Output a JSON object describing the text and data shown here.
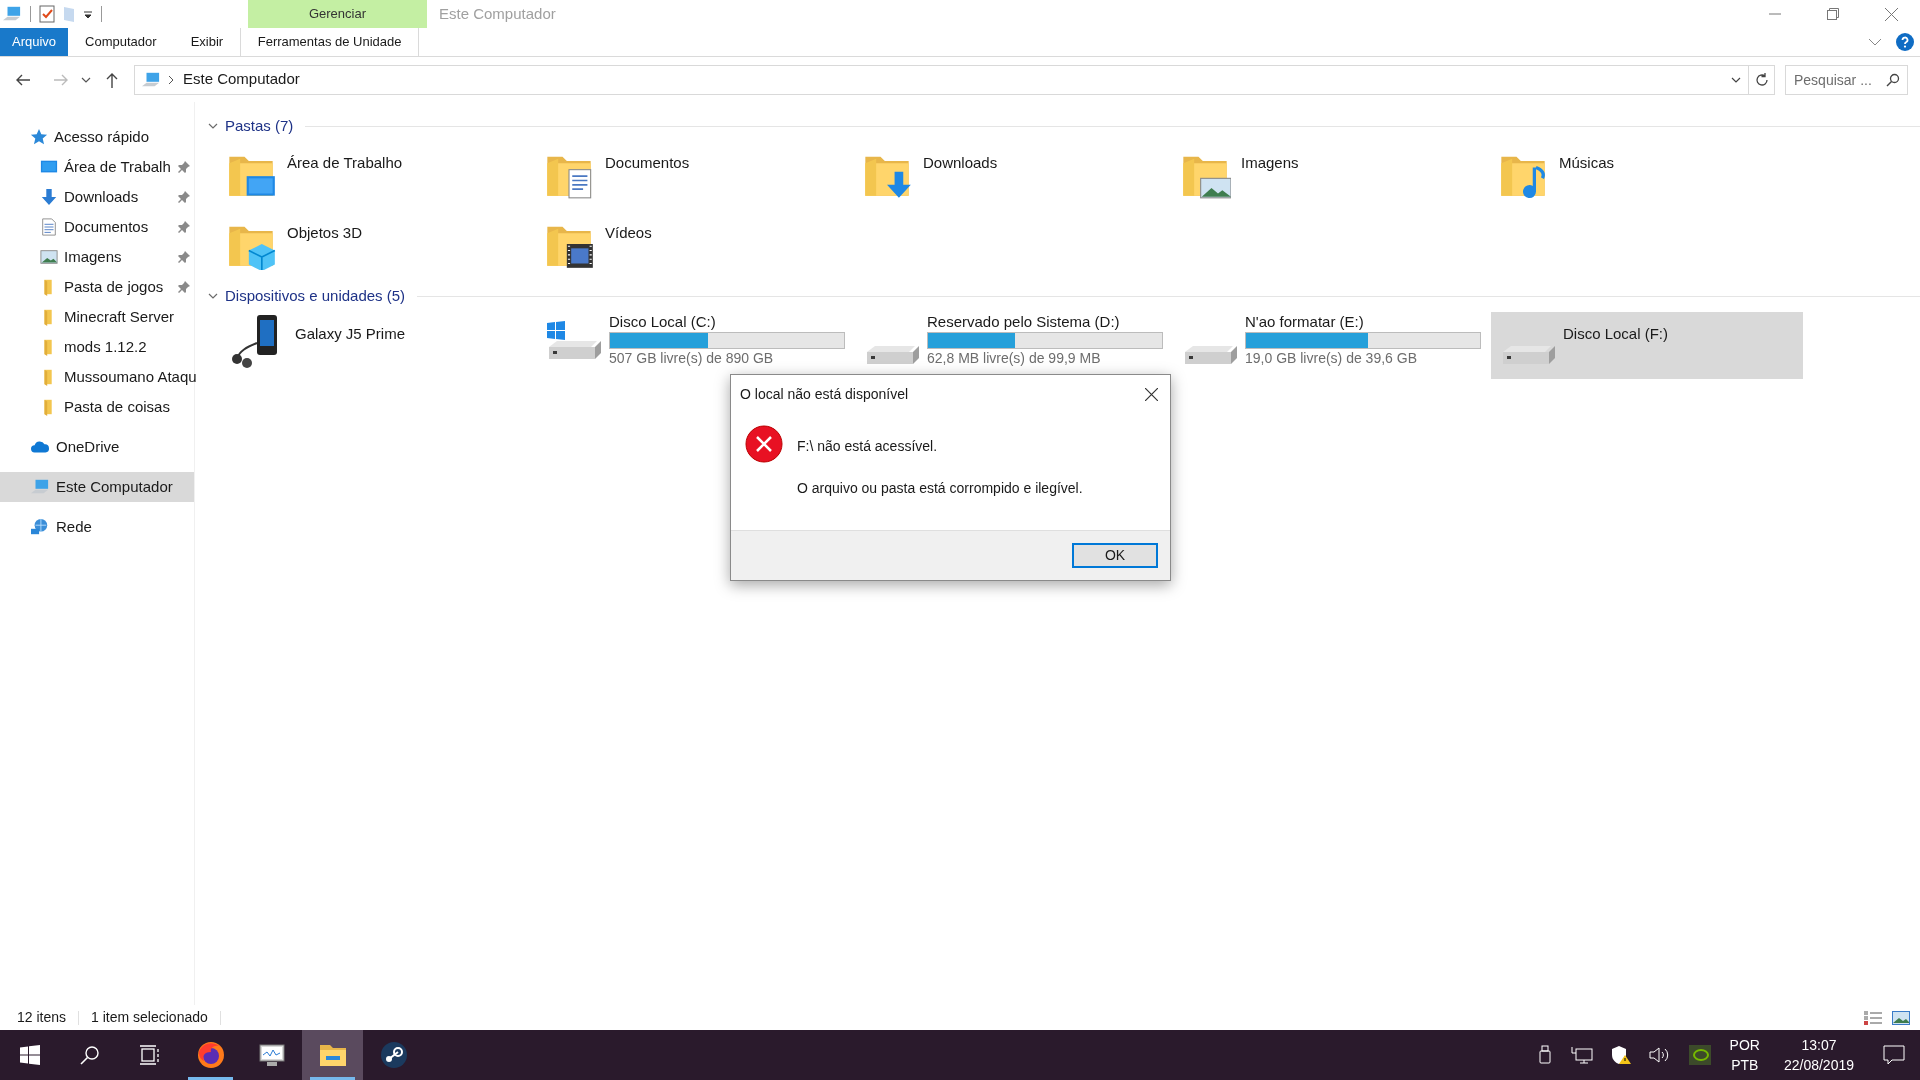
{
  "window": {
    "title": "Este Computador"
  },
  "ribbon": {
    "context_group": "Gerenciar",
    "tabs": [
      {
        "label": "Arquivo",
        "kind": "file",
        "selected": false
      },
      {
        "label": "Computador",
        "kind": "tab",
        "selected": false
      },
      {
        "label": "Exibir",
        "kind": "tab",
        "selected": false
      },
      {
        "label": "Ferramentas de Unidade",
        "kind": "context",
        "selected": false
      }
    ]
  },
  "address_bar": {
    "path": "Este Computador"
  },
  "search": {
    "placeholder": "Pesquisar ..."
  },
  "sidebar": {
    "items": [
      {
        "label": "Acesso rápido",
        "kind": "star",
        "selected": false,
        "children": [
          {
            "label": "Área de Trabalh",
            "kind": "desktop",
            "pinned": true
          },
          {
            "label": "Downloads",
            "kind": "downloads",
            "pinned": true
          },
          {
            "label": "Documentos",
            "kind": "documents",
            "pinned": true
          },
          {
            "label": "Imagens",
            "kind": "pictures",
            "pinned": true
          },
          {
            "label": "Pasta de jogos",
            "kind": "folder",
            "pinned": true
          },
          {
            "label": "Minecraft Server",
            "kind": "folder",
            "pinned": false
          },
          {
            "label": "mods 1.12.2",
            "kind": "folder",
            "pinned": false
          },
          {
            "label": "Mussoumano Ataqu",
            "kind": "folder",
            "pinned": false
          },
          {
            "label": "Pasta de coisas",
            "kind": "folder",
            "pinned": false
          }
        ]
      },
      {
        "label": "OneDrive",
        "kind": "cloud",
        "selected": false
      },
      {
        "label": "Este Computador",
        "kind": "computer",
        "selected": true
      },
      {
        "label": "Rede",
        "kind": "network",
        "selected": false
      }
    ]
  },
  "folders": {
    "heading": "Pastas (7)",
    "expanded": true,
    "items": [
      {
        "label": "Área de Trabalho",
        "kind": "desktop"
      },
      {
        "label": "Documentos",
        "kind": "documents"
      },
      {
        "label": "Downloads",
        "kind": "downloads"
      },
      {
        "label": "Imagens",
        "kind": "pictures"
      },
      {
        "label": "Músicas",
        "kind": "music"
      },
      {
        "label": "Objetos 3D",
        "kind": "objects"
      },
      {
        "label": "Vídeos",
        "kind": "videos"
      }
    ]
  },
  "devices": {
    "heading": "Dispositivos e unidades (5)",
    "expanded": true,
    "items": [
      {
        "label": "Galaxy J5 Prime",
        "kind": "phone",
        "selected": false
      },
      {
        "label": "Disco Local (C:)",
        "kind": "system-drive",
        "level": 0.42,
        "free": "507 GB livre(s) de 890 GB",
        "selected": false
      },
      {
        "label": "Reservado pelo Sistema (D:)",
        "kind": "drive",
        "level": 0.37,
        "free": "62,8 MB livre(s) de 99,9 MB",
        "selected": false
      },
      {
        "label": "N'ao formatar (E:)",
        "kind": "drive",
        "level": 0.52,
        "free": "19,0 GB livre(s) de 39,6 GB",
        "selected": false
      },
      {
        "label": "Disco Local (F:)",
        "kind": "drive",
        "selected": true
      }
    ]
  },
  "dialog": {
    "title": "O local não está disponível",
    "message": "F:\\ não está acessível.",
    "detail": "O arquivo ou pasta está corrompido e ilegível.",
    "buttons": [
      {
        "label": "OK",
        "default": true
      }
    ]
  },
  "status_bar": {
    "item_count": "12 itens",
    "selection": "1 item selecionado"
  },
  "taskbar": {
    "apps": [
      {
        "kind": "firefox",
        "running": true,
        "active": false
      },
      {
        "kind": "monitor",
        "running": false,
        "active": false
      },
      {
        "kind": "explorer",
        "running": true,
        "active": true
      },
      {
        "kind": "steam",
        "running": false,
        "active": false
      }
    ],
    "language": [
      "POR",
      "PTB"
    ],
    "time": "13:07",
    "date": "22/08/2019"
  }
}
